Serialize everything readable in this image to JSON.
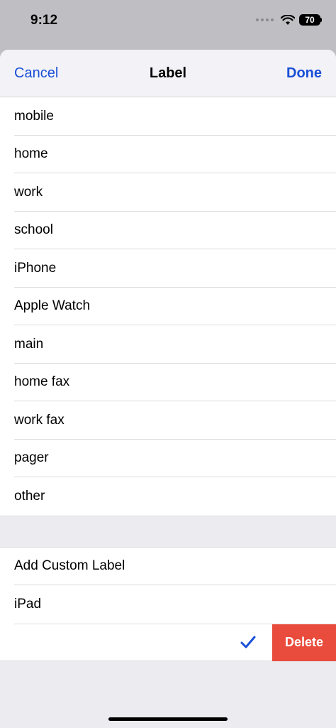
{
  "status": {
    "time": "9:12",
    "battery": "70"
  },
  "nav": {
    "cancel": "Cancel",
    "title": "Label",
    "done": "Done"
  },
  "labels": [
    "mobile",
    "home",
    "work",
    "school",
    "iPhone",
    "Apple Watch",
    "main",
    "home fax",
    "work fax",
    "pager",
    "other"
  ],
  "custom": {
    "add": "Add Custom Label",
    "items": [
      "iPad"
    ]
  },
  "edit_row": {
    "delete": "Delete",
    "check_icon": "checkmark-icon"
  },
  "colors": {
    "accent": "#1a4fd6",
    "delete": "#e94b3c"
  }
}
